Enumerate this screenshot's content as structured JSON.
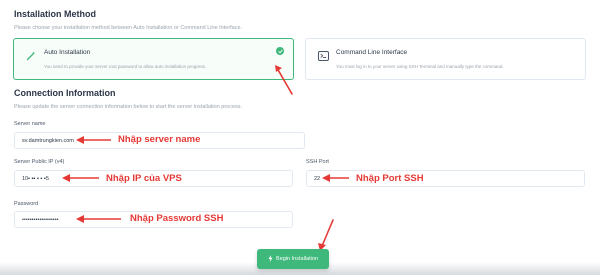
{
  "installation": {
    "title": "Installation Method",
    "description": "Please choose your installation method between Auto Installation or Command Line Interface.",
    "auto": {
      "title": "Auto Installation",
      "description": "You need to provide your server root password to allow auto installation progress.",
      "selected": true
    },
    "cli": {
      "title": "Command Line Interface",
      "description": "You must log in to your server using SSH Terminal and manually type the command."
    }
  },
  "connection": {
    "title": "Connection Information",
    "description": "Please update the server connection information below to start the server installation process.",
    "server_name": {
      "label": "Server name",
      "value": "sv.damtrungkien.com"
    },
    "public_ip": {
      "label": "Server Public IP (v4)",
      "value": "10▪ ▪▪ ▪ ▪ ▪5"
    },
    "ssh_port": {
      "label": "SSH Port",
      "value": "22"
    },
    "password": {
      "label": "Password",
      "value": "•••••••••••••••••••"
    }
  },
  "annotations": {
    "server_name": "Nhập server name",
    "ip": "Nhập IP của VPS",
    "port": "Nhập Port SSH",
    "password": "Nhập Password SSH"
  },
  "actions": {
    "begin_label": "Begin Installation"
  },
  "colors": {
    "accent": "#3fb87b",
    "annotation": "#e53935"
  }
}
